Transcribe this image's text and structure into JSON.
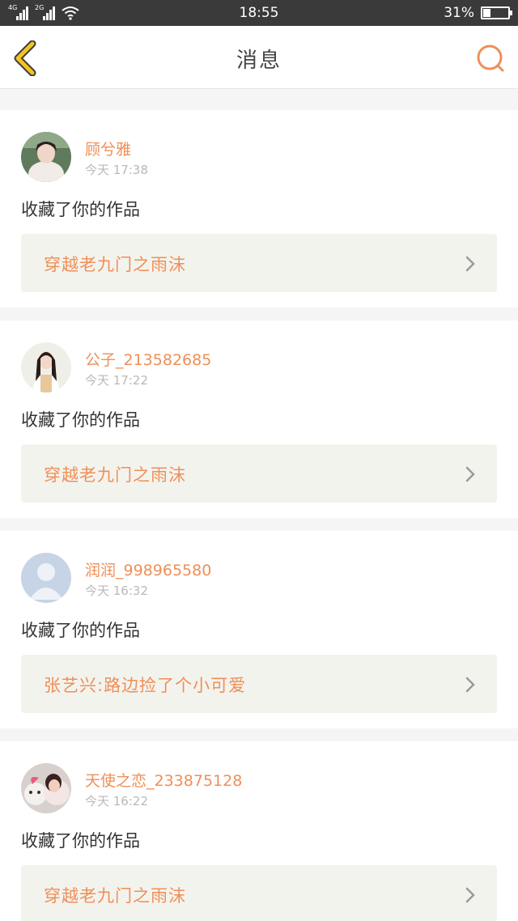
{
  "status_bar": {
    "network1": "4G",
    "network2": "2G",
    "time": "18:55",
    "battery_text": "31%",
    "battery_level": 0.31
  },
  "header": {
    "title": "消息",
    "back_icon": "chevron-left-icon",
    "search_icon": "search-icon"
  },
  "colors": {
    "accent": "#ef8f57",
    "back_icon": "#f3c41f",
    "status_bar": "#3a3a3a"
  },
  "messages": [
    {
      "username": "顾兮雅",
      "time": "今天 17:38",
      "action": "收藏了你的作品",
      "work_title": "穿越老九门之雨沫"
    },
    {
      "username": "公子_213582685",
      "time": "今天 17:22",
      "action": "收藏了你的作品",
      "work_title": "穿越老九门之雨沫"
    },
    {
      "username": "润润_998965580",
      "time": "今天 16:32",
      "action": "收藏了你的作品",
      "work_title": "张艺兴:路边捡了个小可爱"
    },
    {
      "username": "天使之恋_233875128",
      "time": "今天 16:22",
      "action": "收藏了你的作品",
      "work_title": "穿越老九门之雨沫"
    }
  ]
}
